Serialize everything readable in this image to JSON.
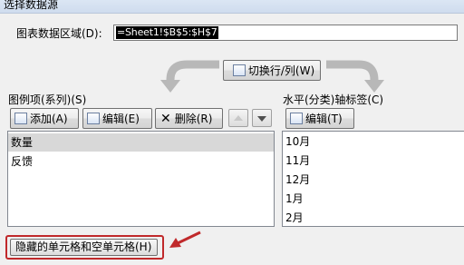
{
  "window": {
    "title": "选择数据源"
  },
  "range": {
    "label": "图表数据区域(D):",
    "value": "=Sheet1!$B$5:$H$7"
  },
  "switch_button": {
    "label": "切换行/列(W)"
  },
  "legend": {
    "title": "图例项(系列)(S)",
    "add_label": "添加(A)",
    "edit_label": "编辑(E)",
    "delete_label": "删除(R)",
    "items": [
      "数量",
      "反馈"
    ]
  },
  "axis": {
    "title": "水平(分类)轴标签(C)",
    "edit_label": "编辑(T)",
    "items": [
      "10月",
      "11月",
      "12月",
      "1月",
      "2月"
    ]
  },
  "hidden_cells_button": {
    "label": "隐藏的单元格和空单元格(H)"
  },
  "colors": {
    "annotation": "#c0292b"
  }
}
